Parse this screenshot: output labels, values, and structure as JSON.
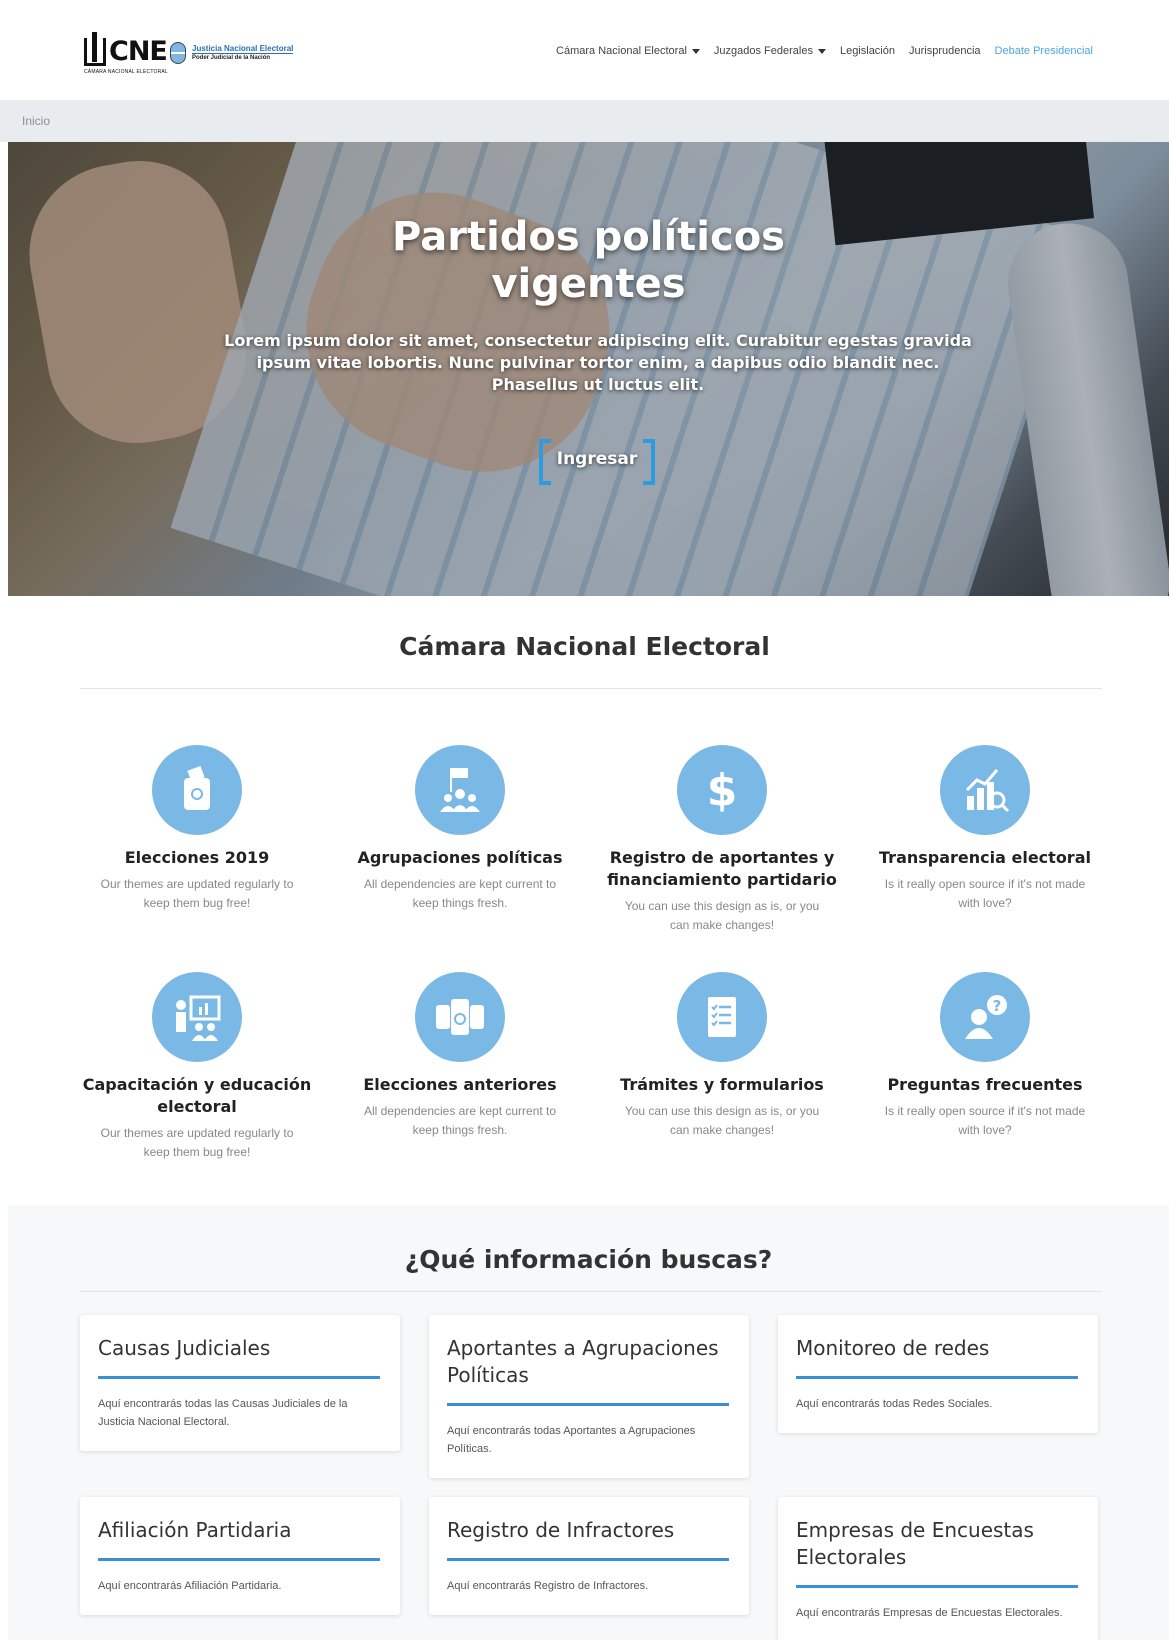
{
  "header": {
    "logo_cne_text": "CNE",
    "logo_cne_sub": "CÁMARA NACIONAL ELECTORAL",
    "logo_jne_title": "Justicia Nacional Electoral",
    "logo_jne_sub": "Poder Judicial de la Nación",
    "nav": [
      {
        "label": "Cámara Nacional Electoral",
        "dropdown": true
      },
      {
        "label": "Juzgados Federales",
        "dropdown": true
      },
      {
        "label": "Legislación",
        "dropdown": false
      },
      {
        "label": "Jurisprudencia",
        "dropdown": false
      },
      {
        "label": "Debate Presidencial",
        "dropdown": false,
        "active": true
      }
    ]
  },
  "breadcrumb": {
    "current": "Inicio"
  },
  "hero": {
    "title": "Partidos políticos vigentes",
    "text": "Lorem ipsum dolor sit amet, consectetur adipiscing elit. Curabitur egestas gravida ipsum vitae lobortis. Nunc pulvinar tortor enim, a dapibus odio blandit nec. Phasellus ut luctus elit.",
    "button": "Ingresar"
  },
  "cne_section": {
    "title": "Cámara Nacional Electoral",
    "features": [
      {
        "title": "Elecciones 2019",
        "text": "Our themes are updated regularly to keep them bug free!",
        "icon": "ballot-box-icon"
      },
      {
        "title": "Agrupaciones políticas",
        "text": "All dependencies are kept current to keep things fresh.",
        "icon": "group-flag-icon"
      },
      {
        "title": "Registro de aportantes y financiamiento partidario",
        "text": "You can use this design as is, or you can make changes!",
        "icon": "dollar-icon"
      },
      {
        "title": "Transparencia electoral",
        "text": "Is it really open source if it's not made with love?",
        "icon": "chart-magnifier-icon"
      },
      {
        "title": "Capacitación y educación electoral",
        "text": "Our themes are updated regularly to keep them bug free!",
        "icon": "presentation-icon"
      },
      {
        "title": "Elecciones anteriores",
        "text": "All dependencies are kept current to keep things fresh.",
        "icon": "ballots-icon"
      },
      {
        "title": "Trámites y formularios",
        "text": "You can use this design as is, or you can make changes!",
        "icon": "checklist-icon"
      },
      {
        "title": "Preguntas frecuentes",
        "text": "Is it really open source if it's not made with love?",
        "icon": "question-user-icon"
      }
    ]
  },
  "info_section": {
    "title": "¿Qué información buscas?",
    "cards": [
      {
        "title": "Causas Judiciales",
        "text": "Aquí encontrarás todas las Causas Judiciales de la Justicia Nacional Electoral."
      },
      {
        "title": "Aportantes a Agrupaciones Políticas",
        "text": "Aquí encontrarás todas Aportantes a Agrupaciones Políticas."
      },
      {
        "title": "Monitoreo de redes",
        "text": "Aquí encontrarás todas Redes Sociales."
      },
      {
        "title": "Afiliación Partidaria",
        "text": "Aquí encontrarás Afiliación Partidaria."
      },
      {
        "title": "Registro de Infractores",
        "text": "Aquí encontrarás Registro de Infractores."
      },
      {
        "title": "Empresas de Encuestas Electorales",
        "text": "Aquí encontrarás Empresas de Encuestas Electorales."
      }
    ]
  },
  "colors": {
    "accent": "#3a8fd9",
    "icon_circle": "#7ab9e6",
    "nav_active": "#4ea5e3",
    "breadcrumb_bg": "#e9ecef"
  }
}
